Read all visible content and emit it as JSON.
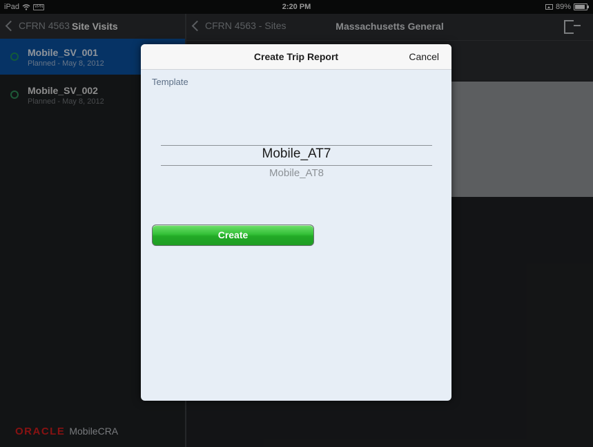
{
  "statusbar": {
    "device": "iPad",
    "vpn": "VPN",
    "time": "2:20 PM",
    "battery": "89%",
    "battery_level": 0.89
  },
  "master": {
    "back_label": "CFRN 4563",
    "title": "Site Visits",
    "visits": [
      {
        "name": "Mobile_SV_001",
        "sub": "Planned - May 8, 2012",
        "selected": true
      },
      {
        "name": "Mobile_SV_002",
        "sub": "Planned - May 8, 2012",
        "selected": false
      }
    ],
    "brand_oracle": "ORACLE",
    "brand_product": "MobileCRA"
  },
  "detail": {
    "back_label": "CFRN 4563 - Sites",
    "title": "Massachusetts General"
  },
  "modal": {
    "title": "Create Trip Report",
    "cancel_label": "Cancel",
    "template_label": "Template",
    "picker": {
      "selected": "Mobile_AT7",
      "next": "Mobile_AT8"
    },
    "create_label": "Create"
  },
  "colors": {
    "selection": "#0a4f9c",
    "create_button": "#2db531",
    "oracle_red": "#d01d1d"
  },
  "icons": [
    "wifi-icon",
    "battery-icon",
    "back-chevron-icon",
    "status-ring-icon",
    "exit-icon"
  ]
}
